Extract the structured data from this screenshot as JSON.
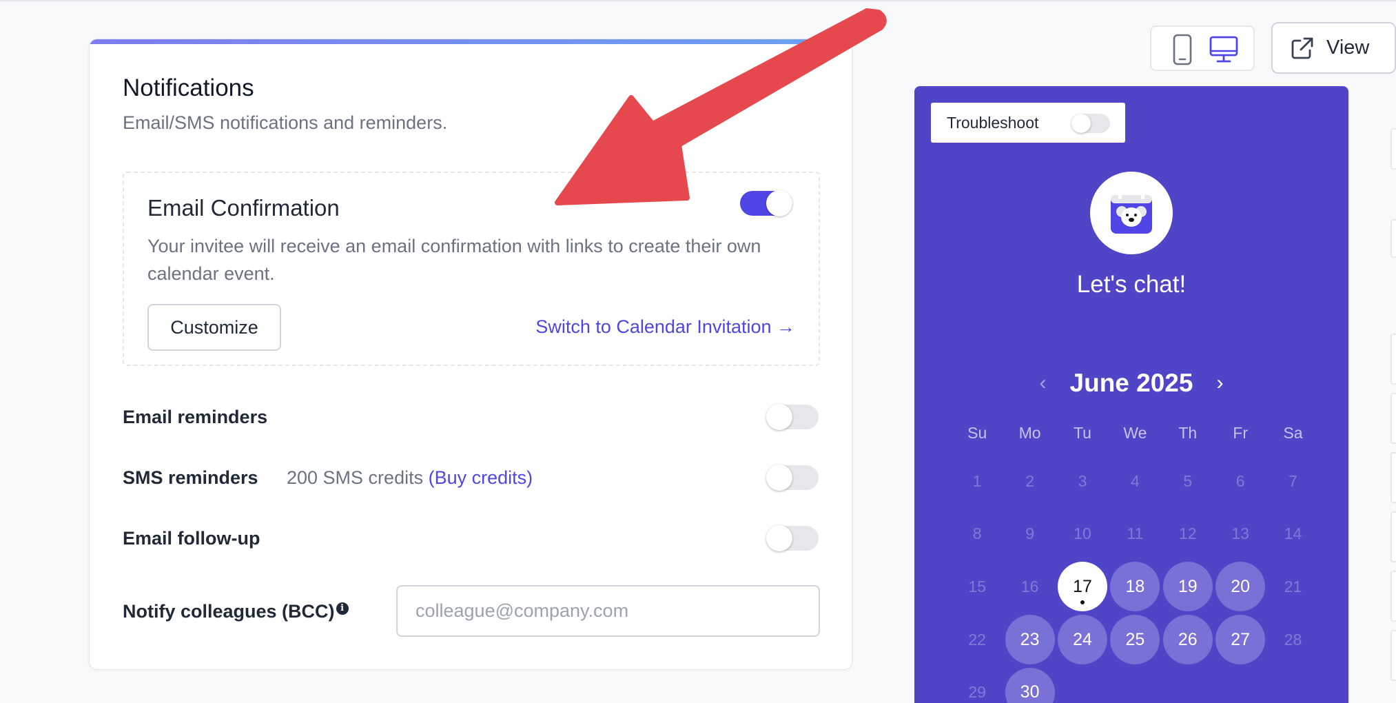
{
  "notifications": {
    "title": "Notifications",
    "subtitle": "Email/SMS notifications and reminders.",
    "email_confirmation": {
      "title": "Email Confirmation",
      "description": "Your invitee will receive an email confirmation with links to create their own calendar event.",
      "enabled": true,
      "customize_label": "Customize",
      "switch_link": "Switch to Calendar Invitation →"
    },
    "email_reminders": {
      "label": "Email reminders",
      "enabled": false
    },
    "sms_reminders": {
      "label": "SMS reminders",
      "credits": "200 SMS credits",
      "buy_credits": "(Buy credits)",
      "enabled": false
    },
    "email_followup": {
      "label": "Email follow-up",
      "enabled": false
    },
    "bcc": {
      "label": "Notify colleagues (BCC)",
      "info_icon": "i",
      "placeholder": "colleague@company.com",
      "value": ""
    }
  },
  "toolbar": {
    "view_label": "View",
    "device_mode": "desktop"
  },
  "preview": {
    "troubleshoot_label": "Troubleshoot",
    "troubleshoot_enabled": false,
    "title": "Let's chat!",
    "month": "June 2025",
    "prev_icon": "‹",
    "next_icon": "›",
    "weekdays": [
      "Su",
      "Mo",
      "Tu",
      "We",
      "Th",
      "Fr",
      "Sa"
    ],
    "days": [
      {
        "d": "1",
        "s": "disabled"
      },
      {
        "d": "2",
        "s": "disabled"
      },
      {
        "d": "3",
        "s": "disabled"
      },
      {
        "d": "4",
        "s": "disabled"
      },
      {
        "d": "5",
        "s": "disabled"
      },
      {
        "d": "6",
        "s": "disabled"
      },
      {
        "d": "7",
        "s": "disabled"
      },
      {
        "d": "8",
        "s": "disabled"
      },
      {
        "d": "9",
        "s": "disabled"
      },
      {
        "d": "10",
        "s": "disabled"
      },
      {
        "d": "11",
        "s": "disabled"
      },
      {
        "d": "12",
        "s": "disabled"
      },
      {
        "d": "13",
        "s": "disabled"
      },
      {
        "d": "14",
        "s": "disabled"
      },
      {
        "d": "15",
        "s": "disabled"
      },
      {
        "d": "16",
        "s": "disabled"
      },
      {
        "d": "17",
        "s": "selected"
      },
      {
        "d": "18",
        "s": "available"
      },
      {
        "d": "19",
        "s": "available"
      },
      {
        "d": "20",
        "s": "available"
      },
      {
        "d": "21",
        "s": "disabled"
      },
      {
        "d": "22",
        "s": "disabled"
      },
      {
        "d": "23",
        "s": "available"
      },
      {
        "d": "24",
        "s": "available"
      },
      {
        "d": "25",
        "s": "available"
      },
      {
        "d": "26",
        "s": "available"
      },
      {
        "d": "27",
        "s": "available"
      },
      {
        "d": "28",
        "s": "disabled"
      },
      {
        "d": "29",
        "s": "disabled"
      },
      {
        "d": "30",
        "s": "available"
      }
    ]
  },
  "colors": {
    "accent": "#4f46e5",
    "preview_bg": "#5045c6",
    "annotation_arrow": "#e5484d"
  }
}
